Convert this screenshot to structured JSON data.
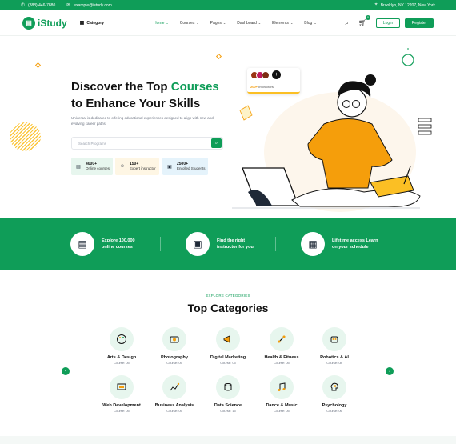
{
  "topbar": {
    "phone": "(888) 446-7880",
    "email": "example@istudy.com",
    "location": "Brooklyn, NY 12207, New York"
  },
  "nav": {
    "logo_text": "iStudy",
    "category_label": "Category",
    "menu": [
      "Home",
      "Courses",
      "Pages",
      "Dashboard",
      "Elements",
      "Blog"
    ],
    "cart_count": "0",
    "login_label": "Login",
    "register_label": "Register"
  },
  "hero": {
    "title_part1": "Discover the Top ",
    "title_highlight": "Courses",
    "title_part2": "to Enhance Your Skills",
    "description": "Universal is dedicated to offering educational experiences designed to align with new and evolving career paths.",
    "search_placeholder": "Search Programs",
    "stats": [
      {
        "value": "4000+",
        "label": "Online courses"
      },
      {
        "value": "150+",
        "label": "Expert instructor"
      },
      {
        "value": "2500+",
        "label": "Enrolled Students"
      }
    ],
    "instructors_card": {
      "count": "200+",
      "label": "Instructors"
    }
  },
  "features": [
    {
      "line1": "Explore 100,000",
      "line2": "online courses"
    },
    {
      "line1": "Find the right",
      "line2": "instructor for you"
    },
    {
      "line1": "Lifetime access Learn",
      "line2": "on your schedule"
    }
  ],
  "categories_section": {
    "kicker": "EXPLORE CATEGORIES",
    "title": "Top Categories",
    "items": [
      {
        "name": "Arts & Design",
        "count": "Course: 05",
        "icon": "palette-icon"
      },
      {
        "name": "Photography",
        "count": "Course: 05",
        "icon": "camera-icon"
      },
      {
        "name": "Digital Marketing",
        "count": "Course: 05",
        "icon": "megaphone-icon"
      },
      {
        "name": "Health & Fitness",
        "count": "Course: 05",
        "icon": "dumbbell-icon"
      },
      {
        "name": "Robotics & AI",
        "count": "Course: 08",
        "icon": "robot-icon"
      },
      {
        "name": "Web Development",
        "count": "Course: 05",
        "icon": "monitor-icon"
      },
      {
        "name": "Business Analysis",
        "count": "Course: 05",
        "icon": "chart-icon"
      },
      {
        "name": "Data Science",
        "count": "Course: 15",
        "icon": "database-icon"
      },
      {
        "name": "Dance & Music",
        "count": "Course: 05",
        "icon": "music-icon"
      },
      {
        "name": "Psychology",
        "count": "Course: 06",
        "icon": "brain-icon"
      }
    ]
  },
  "colors": {
    "primary": "#0f9d58",
    "accent": "#fbbf24",
    "illustration_orange": "#f59e0b"
  }
}
